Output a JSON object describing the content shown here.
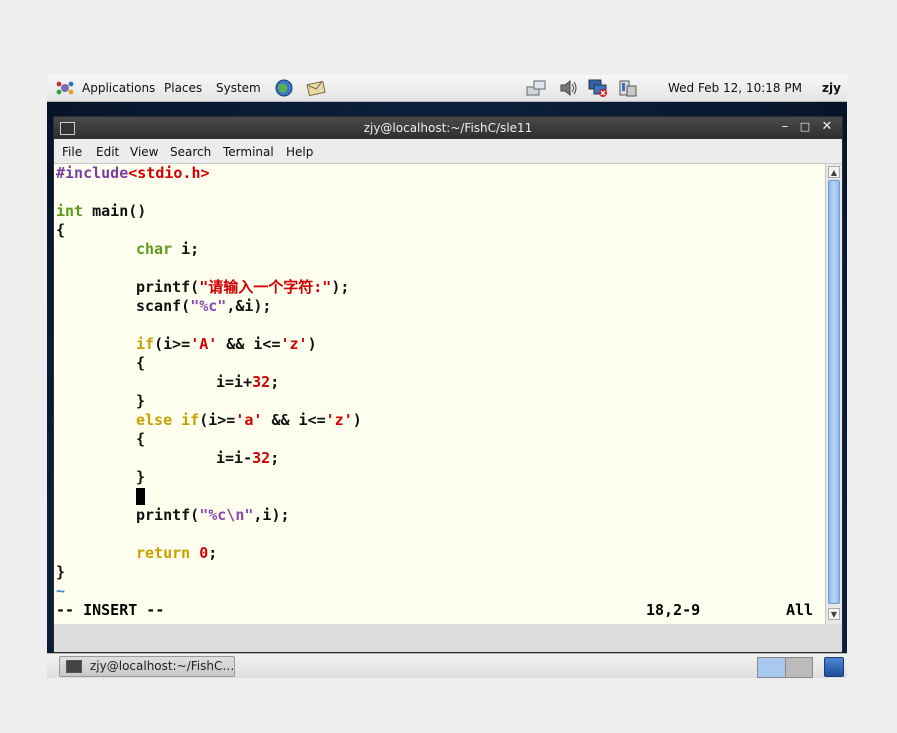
{
  "top_panel": {
    "applications": "Applications",
    "places": "Places",
    "system": "System",
    "clock": "Wed Feb 12, 10:18 PM",
    "user": "zjy"
  },
  "window": {
    "title": "zjy@localhost:~/FishC/sle11",
    "menu": [
      "File",
      "Edit",
      "View",
      "Search",
      "Terminal",
      "Help"
    ]
  },
  "code": {
    "include_kw": "#include",
    "include_hdr": "<stdio.h>",
    "int_kw": "int",
    "main_sig": " main()",
    "open_brace": "{",
    "char_kw": "char",
    "char_decl": " i;",
    "printf1_pre": "printf(",
    "printf1_str": "\"请输入一个字符:\"",
    "printf1_post": ");",
    "scanf_pre": "scanf(",
    "scanf_str": "\"%c\"",
    "scanf_post": ",&i);",
    "if_kw": "if",
    "if_cond_a": "(i>=",
    "lit_A": "'A'",
    "if_cond_b": " && i<=",
    "lit_z": "'z'",
    "close_paren": ")",
    "inner_open": "{",
    "assign_plus": "i=i+",
    "num32": "32",
    "semicolon": ";",
    "inner_close": "}",
    "else_if_kw": "else if",
    "elif_cond_a": "(i>=",
    "lit_a": "'a'",
    "elif_cond_b": " && i<=",
    "lit_z2": "'z'",
    "assign_minus": "i=i-",
    "printf2_pre": "printf(",
    "printf2_str": "\"%c\\n\"",
    "printf2_post": ",i);",
    "return_kw": "return",
    "zero": "0",
    "close_brace": "}",
    "tilde": "~"
  },
  "status": {
    "mode": "-- INSERT --",
    "position": "18,2-9",
    "scroll": "All"
  },
  "taskbar": {
    "task_label": "zjy@localhost:~/FishC…"
  }
}
